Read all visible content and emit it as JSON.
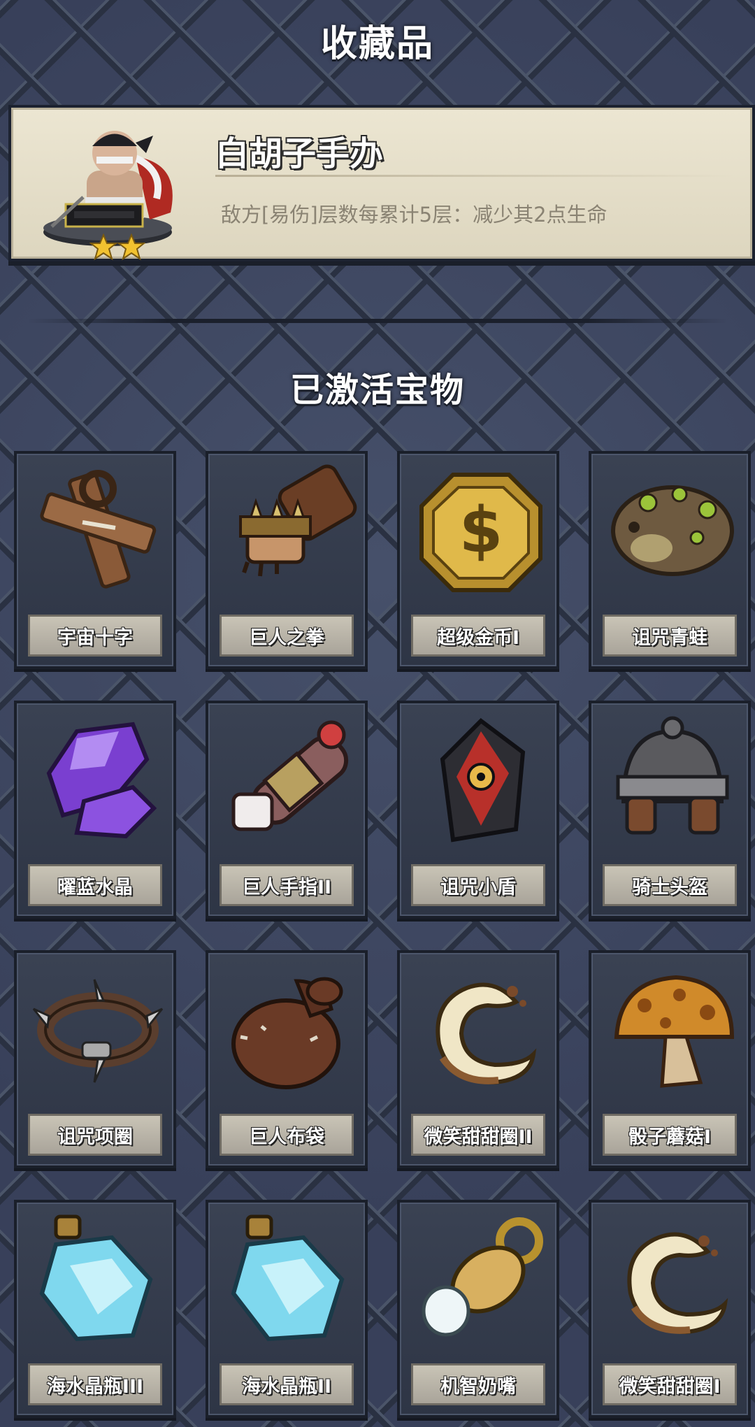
{
  "page_title": "收藏品",
  "featured": {
    "name": "白胡子手办",
    "description": "敌方[易伤]层数每累计5层：减少其2点生命",
    "stars": 2,
    "icon": "whitebeard-figure-icon"
  },
  "section_title": "已激活宝物",
  "treasures": [
    {
      "name": "宇宙十字",
      "icon": "wooden-cross-icon"
    },
    {
      "name": "巨人之拳",
      "icon": "giant-fist-icon"
    },
    {
      "name": "超级金币I",
      "icon": "gold-coin-icon"
    },
    {
      "name": "诅咒青蛙",
      "icon": "cursed-frog-icon"
    },
    {
      "name": "曜蓝水晶",
      "icon": "purple-crystal-icon"
    },
    {
      "name": "巨人手指II",
      "icon": "giant-finger-icon"
    },
    {
      "name": "诅咒小盾",
      "icon": "cursed-shield-icon"
    },
    {
      "name": "骑士头盔",
      "icon": "knight-helmet-icon"
    },
    {
      "name": "诅咒项圈",
      "icon": "spiked-collar-icon"
    },
    {
      "name": "巨人布袋",
      "icon": "cloth-sack-icon"
    },
    {
      "name": "微笑甜甜圈II",
      "icon": "smile-donut-icon"
    },
    {
      "name": "骰子蘑菇I",
      "icon": "dice-mushroom-icon"
    },
    {
      "name": "海水晶瓶III",
      "icon": "crystal-bottle-icon"
    },
    {
      "name": "海水晶瓶II",
      "icon": "crystal-bottle-icon"
    },
    {
      "name": "机智奶嘴",
      "icon": "pacifier-icon"
    },
    {
      "name": "微笑甜甜圈I",
      "icon": "smile-donut-icon"
    }
  ]
}
